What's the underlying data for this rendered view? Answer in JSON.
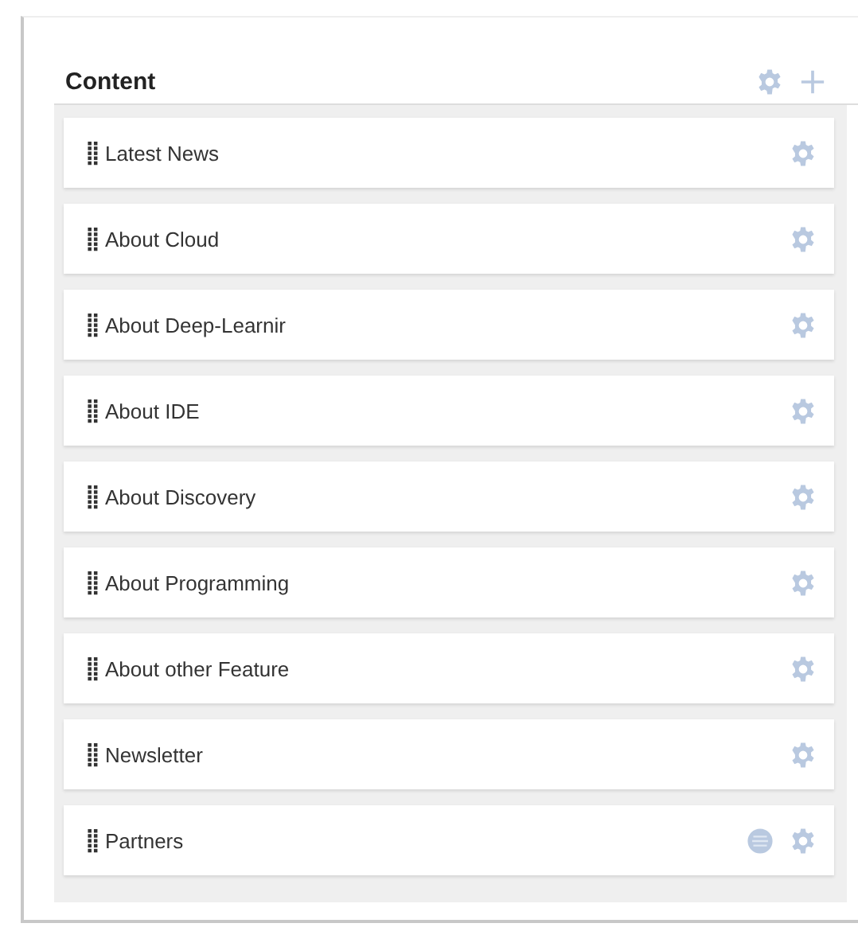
{
  "panel": {
    "title": "Content"
  },
  "items": [
    {
      "label": "Latest News",
      "list_icon": false
    },
    {
      "label": "About Cloud",
      "list_icon": false
    },
    {
      "label": "About Deep-Learnir",
      "list_icon": false
    },
    {
      "label": "About IDE",
      "list_icon": false
    },
    {
      "label": "About Discovery",
      "list_icon": false
    },
    {
      "label": "About Programming",
      "list_icon": false
    },
    {
      "label": "About other Feature",
      "list_icon": false
    },
    {
      "label": "Newsletter",
      "list_icon": false
    },
    {
      "label": "Partners",
      "list_icon": true
    }
  ]
}
